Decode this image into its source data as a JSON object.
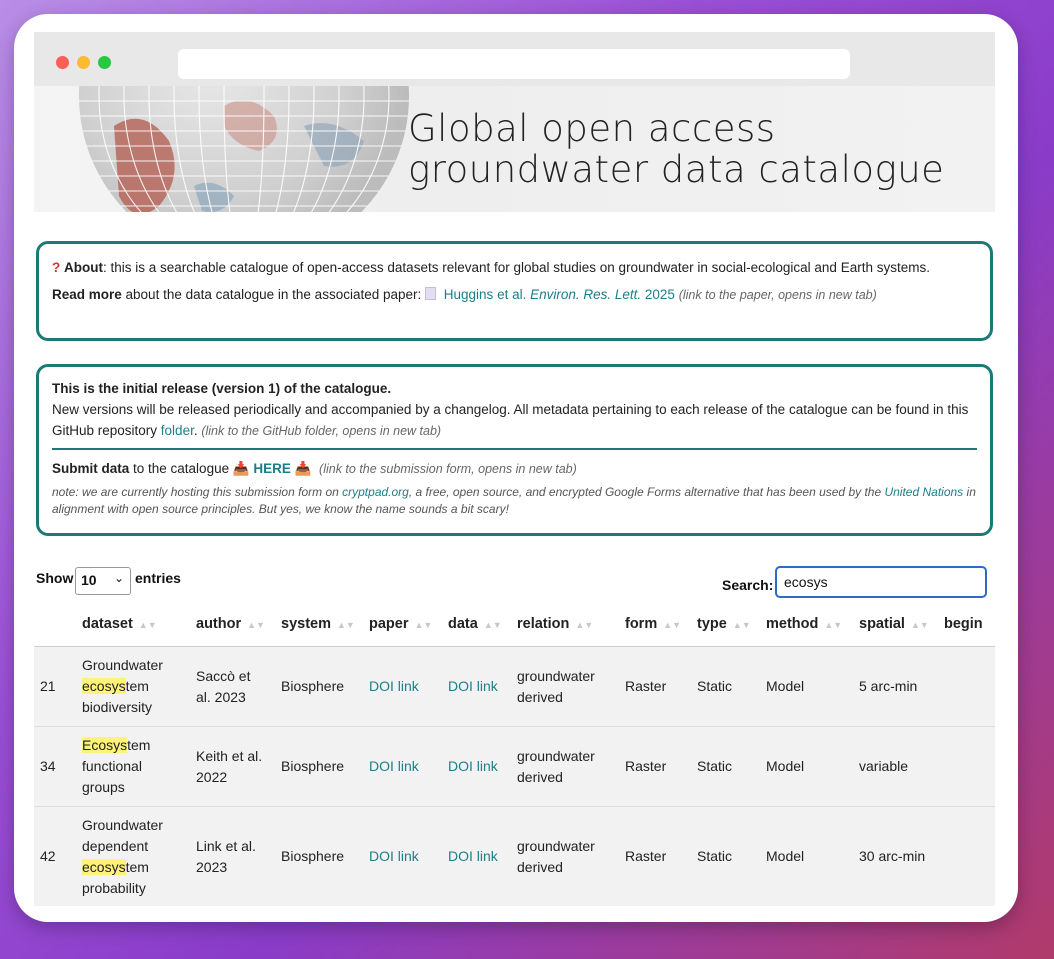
{
  "banner": {
    "title_line1": "Global open access",
    "title_line2": "groundwater data catalogue"
  },
  "about": {
    "icon": "question-mark-icon",
    "label": "About",
    "text": ": this is a searchable catalogue of open-access datasets relevant for global studies on groundwater in social-ecological and Earth systems.",
    "readmore_label": "Read more",
    "readmore_text": " about the data catalogue in the associated paper: ",
    "paper_link_authors": "Huggins et al. ",
    "paper_link_journal": "Environ. Res. Lett.",
    "paper_link_year": " 2025",
    "paper_hint": "(link to the paper, opens in new tab)"
  },
  "release": {
    "heading": "This is the initial release (version 1) of the catalogue.",
    "text": "New versions will be released periodically and accompanied by a changelog. All metadata pertaining to each release of the catalogue can be found in this GitHub repository ",
    "folder_link": "folder",
    "folder_after": ". ",
    "folder_hint": "(link to the GitHub folder, opens in new tab)",
    "submit_label": "Submit data",
    "submit_text": " to the catalogue ",
    "here_link": "HERE",
    "submit_hint": "(link to the submission form, opens in new tab)",
    "note_before": "note: we are currently hosting this submission form on ",
    "note_link1": "cryptpad.org",
    "note_middle": ", a free, open source, and encrypted Google Forms alternative that has been used by the ",
    "note_link2": "United Nations",
    "note_after": " in alignment with open source principles. But yes, we know the name sounds a bit scary!"
  },
  "controls": {
    "show_label": "Show",
    "entries_value": "10",
    "entries_label": "entries",
    "search_label": "Search:",
    "search_value": "ecosys"
  },
  "table": {
    "headers": [
      "dataset",
      "author",
      "system",
      "paper",
      "data",
      "relation",
      "form",
      "type",
      "method",
      "spatial",
      "begin"
    ],
    "rows": [
      {
        "id": "21",
        "dataset_before": "Groundwater",
        "dataset_hl": "ecosys",
        "dataset_after": "tem biodiversity",
        "author": "Saccò et al. 2023",
        "system": "Biosphere",
        "paper": "DOI link",
        "data": "DOI link",
        "relation": "groundwater derived",
        "form": "Raster",
        "type": "Static",
        "method": "Model",
        "spatial": "5 arc-min",
        "begin": ""
      },
      {
        "id": "34",
        "dataset_before": "",
        "dataset_hl": "Ecosys",
        "dataset_after": "tem functional groups",
        "author": "Keith et al. 2022",
        "system": "Biosphere",
        "paper": "DOI link",
        "data": "DOI link",
        "relation": "groundwater derived",
        "form": "Raster",
        "type": "Static",
        "method": "Model",
        "spatial": "variable",
        "begin": ""
      },
      {
        "id": "42",
        "dataset_before": "Groundwater dependent",
        "dataset_hl": "ecosys",
        "dataset_after": "tem probability",
        "author": "Link et al. 2023",
        "system": "Biosphere",
        "paper": "DOI link",
        "data": "DOI link",
        "relation": "groundwater derived",
        "form": "Raster",
        "type": "Static",
        "method": "Model",
        "spatial": "30 arc-min",
        "begin": ""
      }
    ]
  },
  "colors": {
    "teal": "#1b7a78",
    "link": "#1b7f8a",
    "highlight": "#fff27a",
    "search_border": "#2b6cc4"
  }
}
